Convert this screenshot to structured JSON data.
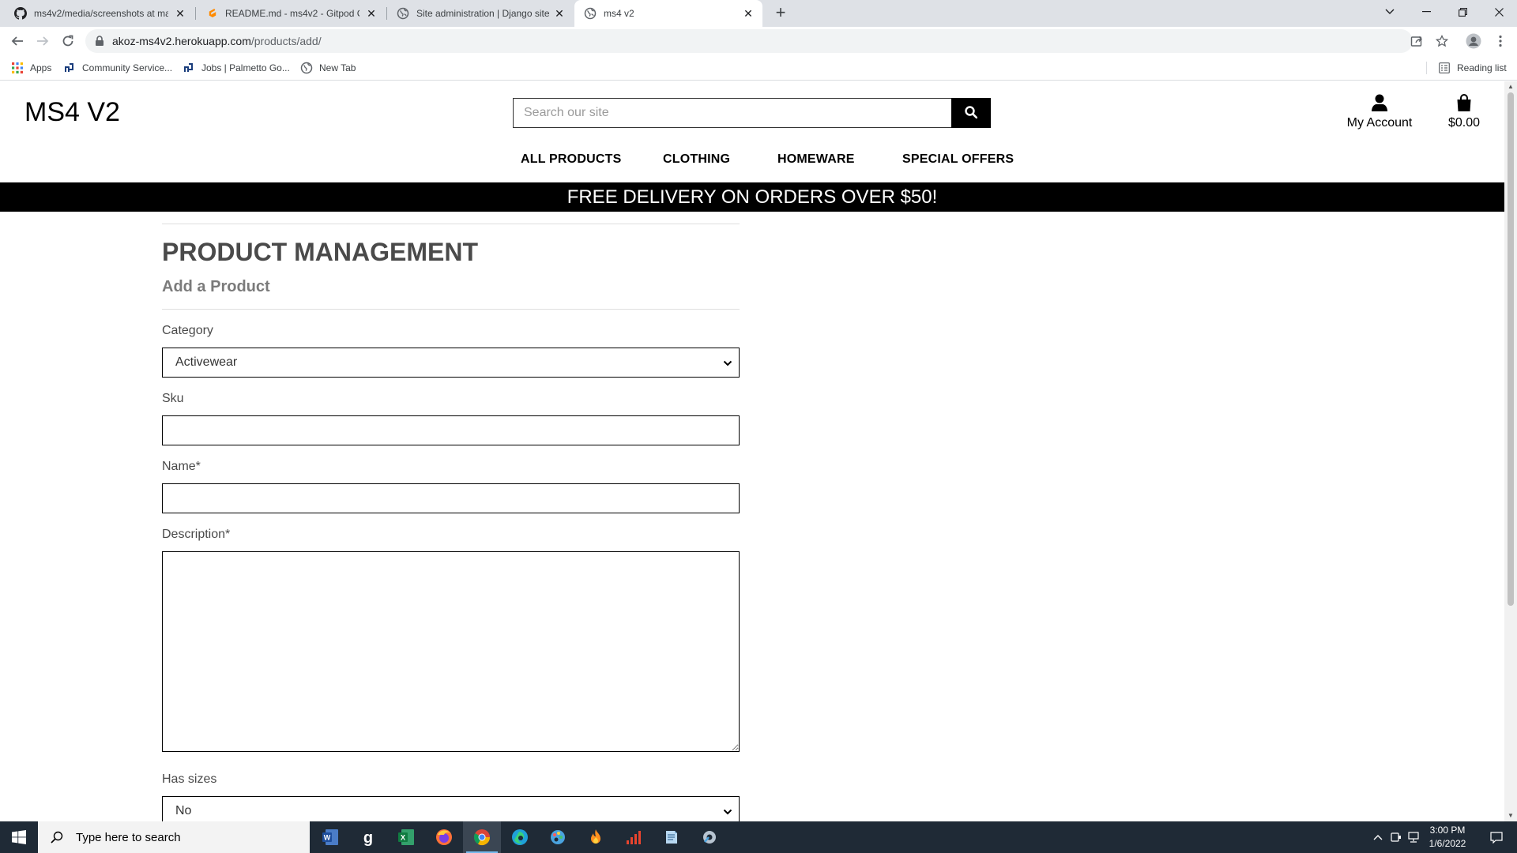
{
  "browser": {
    "tabs": [
      {
        "title": "ms4v2/media/screenshots at ma",
        "icon": "github-icon"
      },
      {
        "title": "README.md - ms4v2 - Gitpod Co",
        "icon": "gitpod-icon"
      },
      {
        "title": "Site administration | Django site",
        "icon": "globe-icon"
      },
      {
        "title": "ms4 v2",
        "icon": "globe-icon",
        "active": true
      }
    ],
    "url_host": "akoz-ms4v2.herokuapp.com",
    "url_path": "/products/add/",
    "bookmarks": [
      {
        "label": "Apps"
      },
      {
        "label": "Community Service..."
      },
      {
        "label": "Jobs | Palmetto Go..."
      },
      {
        "label": "New Tab"
      }
    ],
    "reading_list": "Reading list"
  },
  "site": {
    "logo": "MS4 V2",
    "search_placeholder": "Search our site",
    "account_label": "My Account",
    "bag_total": "$0.00",
    "nav": [
      "ALL PRODUCTS",
      "CLOTHING",
      "HOMEWARE",
      "SPECIAL OFFERS"
    ],
    "banner": "FREE DELIVERY ON ORDERS OVER $50!"
  },
  "form": {
    "title": "PRODUCT MANAGEMENT",
    "subtitle": "Add a Product",
    "category_label": "Category",
    "category_value": "Activewear",
    "sku_label": "Sku",
    "sku_value": "",
    "name_label": "Name*",
    "name_value": "",
    "description_label": "Description*",
    "description_value": "",
    "has_sizes_label": "Has sizes",
    "has_sizes_value": "No"
  },
  "taskbar": {
    "search_placeholder": "Type here to search",
    "time": "3:00 PM",
    "date": "1/6/2022"
  },
  "colors": {
    "banner_bg": "#000000",
    "taskbar_bg": "#1f2a36",
    "tabstrip_bg": "#dee1e6"
  }
}
